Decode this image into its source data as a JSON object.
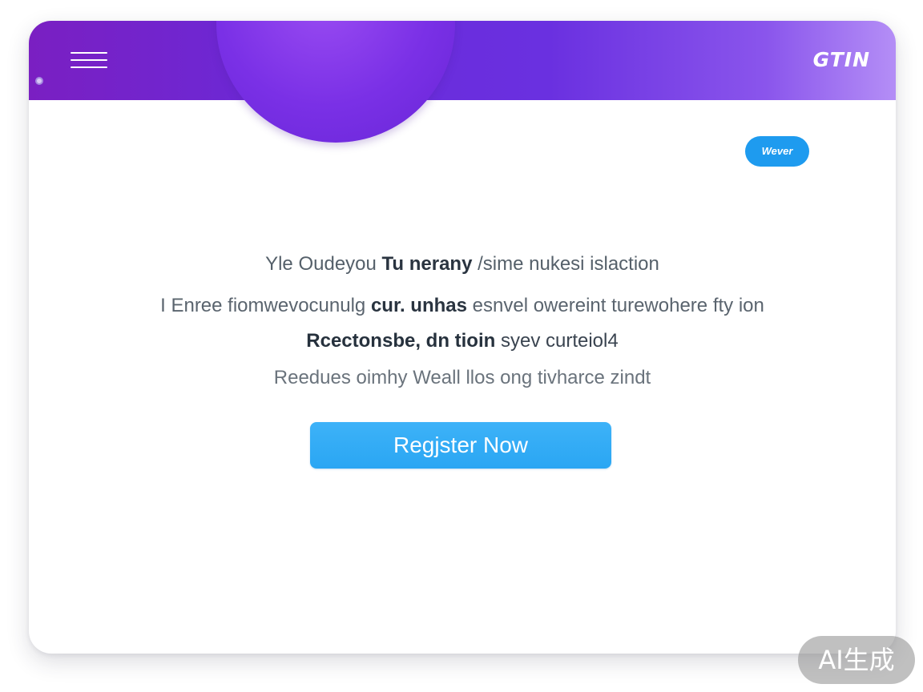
{
  "header": {
    "logo_text": "GTIN"
  },
  "pill_button": {
    "label": "Wever"
  },
  "hero": {
    "line1_pre": "Yle Oudeyou ",
    "line1_bold": "Tu nerany",
    "line1_post": " /sime nukesi islaction",
    "line2_pre": "I Enree fiomwevocunulg ",
    "line2_bold": "cur. unhas",
    "line2_post": " esnvel owereint turewohere fty ion",
    "line3_bold": "Rcectonsbe, dn tioin",
    "line3_post": " syev curteiol4",
    "line4": "Reedues oimhy Weall llos ong tivharce zindt"
  },
  "cta": {
    "label": "Regjster Now"
  },
  "watermark": {
    "text": "AI生成"
  },
  "colors": {
    "header_gradient_start": "#7a1fc2",
    "header_gradient_end": "#b48ef6",
    "accent_blue": "#2aa6f3",
    "pill_blue": "#1e9bef"
  },
  "icons": {
    "menu": "hamburger-menu-icon"
  }
}
